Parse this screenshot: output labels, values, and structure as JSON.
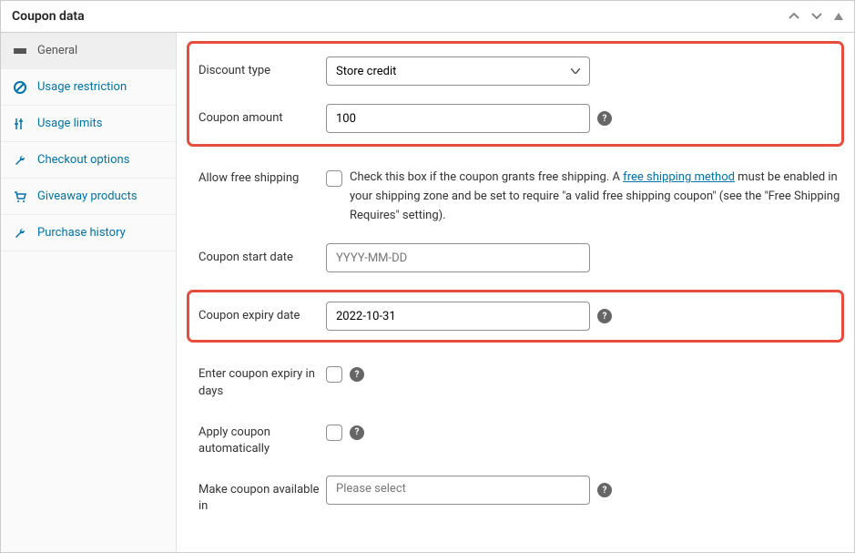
{
  "panel": {
    "title": "Coupon data"
  },
  "sidebar": {
    "items": [
      {
        "label": "General"
      },
      {
        "label": "Usage restriction"
      },
      {
        "label": "Usage limits"
      },
      {
        "label": "Checkout options"
      },
      {
        "label": "Giveaway products"
      },
      {
        "label": "Purchase history"
      }
    ]
  },
  "form": {
    "discount_type": {
      "label": "Discount type",
      "value": "Store credit"
    },
    "coupon_amount": {
      "label": "Coupon amount",
      "value": "100"
    },
    "allow_free_shipping": {
      "label": "Allow free shipping",
      "checked": false,
      "desc_before": "Check this box if the coupon grants free shipping. A ",
      "link_text": "free shipping method",
      "desc_after": " must be enabled in your shipping zone and be set to require \"a valid free shipping coupon\" (see the \"Free Shipping Requires\" setting)."
    },
    "coupon_start_date": {
      "label": "Coupon start date",
      "placeholder": "YYYY-MM-DD",
      "value": ""
    },
    "coupon_expiry_date": {
      "label": "Coupon expiry date",
      "value": "2022-10-31"
    },
    "expiry_in_days": {
      "label": "Enter coupon expiry in days",
      "checked": false
    },
    "apply_auto": {
      "label": "Apply coupon automatically",
      "checked": false
    },
    "available_in": {
      "label": "Make coupon available in",
      "placeholder": "Please select"
    }
  }
}
